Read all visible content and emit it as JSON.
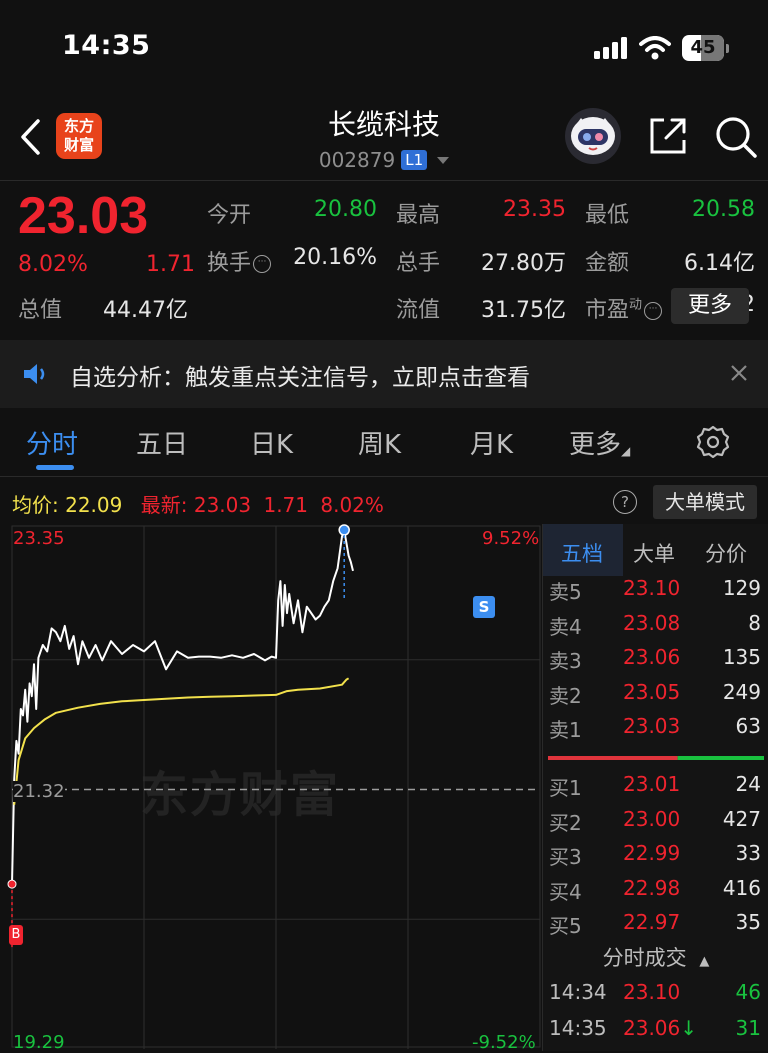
{
  "status": {
    "time": "14:35",
    "battery": "45",
    "battery_level": 0.45
  },
  "header": {
    "logo_line1": "东方",
    "logo_line2": "财富",
    "name": "长缆科技",
    "code": "002879",
    "level_badge": "L1"
  },
  "quote": {
    "price": "23.03",
    "change_pct": "8.02%",
    "change_abs": "1.71",
    "fields": [
      {
        "label": "今开",
        "value": "20.80",
        "color": "green"
      },
      {
        "label": "最高",
        "value": "23.35",
        "color": "red"
      },
      {
        "label": "最低",
        "value": "20.58",
        "color": "green"
      },
      {
        "label": "换手",
        "value": "20.16%",
        "color": "white"
      },
      {
        "label": "总手",
        "value": "27.80万",
        "color": "white"
      },
      {
        "label": "金额",
        "value": "6.14亿",
        "color": "white"
      },
      {
        "label": "总值",
        "value": "44.47亿",
        "color": "white"
      },
      {
        "label": "流值",
        "value": "31.75亿",
        "color": "white"
      },
      {
        "label": "市盈",
        "label_sup": "动",
        "value": "99.72",
        "color": "white"
      }
    ],
    "more_label": "更多"
  },
  "notice": {
    "text": "自选分析：触发重点关注信号，立即点击查看"
  },
  "tabs": [
    "分时",
    "五日",
    "日K",
    "周K",
    "月K",
    "更多"
  ],
  "chart_info": {
    "avg_label": "均价:",
    "avg_value": "22.09",
    "latest_label": "最新:",
    "latest_price": "23.03",
    "latest_chg": "1.71",
    "latest_pct": "8.02%",
    "help": "?",
    "mode_label": "大单模式"
  },
  "chart_data": {
    "type": "line",
    "y_max_label": "23.35",
    "y_mid_label": "21.32",
    "y_min_label": "19.29",
    "pct_max_label": "9.52%",
    "pct_min_label": "-9.52%",
    "ylim": [
      19.29,
      23.35
    ],
    "prev_close": 21.32,
    "watermark": "东方财富",
    "buy_marker": "B",
    "sell_marker": "S",
    "series": [
      {
        "name": "price",
        "color": "#ffffff",
        "x": [
          0,
          1,
          2,
          3,
          4,
          5,
          6,
          7,
          8,
          9,
          10,
          11,
          12,
          14,
          16,
          18,
          20,
          22,
          24,
          26,
          28,
          30,
          32,
          35,
          38,
          41,
          45,
          50,
          55,
          60,
          65,
          70,
          75,
          80,
          85,
          90,
          95,
          100,
          105,
          110,
          115,
          118,
          120,
          121,
          122,
          123,
          124,
          125,
          126,
          128,
          130,
          132,
          134,
          136,
          138,
          140,
          142,
          144,
          146,
          148,
          150,
          151,
          152,
          153,
          154,
          155
        ],
        "y": [
          20.58,
          21.4,
          21.7,
          21.6,
          21.95,
          21.9,
          22.1,
          21.85,
          22.15,
          22.05,
          22.3,
          21.95,
          22.35,
          22.45,
          22.4,
          22.58,
          22.55,
          22.48,
          22.6,
          22.42,
          22.52,
          22.3,
          22.48,
          22.35,
          22.45,
          22.33,
          22.48,
          22.38,
          22.45,
          22.4,
          22.48,
          22.26,
          22.4,
          22.35,
          22.36,
          22.36,
          22.35,
          22.37,
          22.35,
          22.38,
          22.33,
          22.36,
          22.35,
          22.8,
          22.95,
          22.6,
          22.92,
          22.7,
          22.85,
          22.62,
          22.8,
          22.55,
          22.75,
          22.7,
          22.65,
          22.68,
          22.75,
          22.8,
          22.95,
          23.05,
          23.3,
          23.35,
          23.25,
          23.15,
          23.1,
          23.03
        ]
      },
      {
        "name": "avg",
        "color": "#f2e14c",
        "x": [
          1,
          3,
          6,
          10,
          15,
          20,
          30,
          40,
          50,
          60,
          70,
          80,
          90,
          100,
          110,
          120,
          125,
          130,
          140,
          150,
          152,
          153
        ],
        "y": [
          21.2,
          21.55,
          21.72,
          21.8,
          21.87,
          21.92,
          21.96,
          21.99,
          22.01,
          22.02,
          22.03,
          22.04,
          22.045,
          22.05,
          22.055,
          22.06,
          22.09,
          22.1,
          22.11,
          22.14,
          22.18,
          22.19
        ]
      }
    ],
    "x_total": 240
  },
  "book": {
    "tabs": [
      "五档",
      "大单",
      "分价"
    ],
    "asks": [
      {
        "label": "卖5",
        "price": "23.10",
        "vol": "129"
      },
      {
        "label": "卖4",
        "price": "23.08",
        "vol": "8"
      },
      {
        "label": "卖3",
        "price": "23.06",
        "vol": "135"
      },
      {
        "label": "卖2",
        "price": "23.05",
        "vol": "249"
      },
      {
        "label": "卖1",
        "price": "23.03",
        "vol": "63"
      }
    ],
    "bids": [
      {
        "label": "买1",
        "price": "23.01",
        "vol": "24"
      },
      {
        "label": "买2",
        "price": "23.00",
        "vol": "427"
      },
      {
        "label": "买3",
        "price": "22.99",
        "vol": "33"
      },
      {
        "label": "买4",
        "price": "22.98",
        "vol": "416"
      },
      {
        "label": "买5",
        "price": "22.97",
        "vol": "35"
      }
    ],
    "ask_ratio": 0.6,
    "ticks_title": "分时成交",
    "ticks": [
      {
        "time": "14:34",
        "price": "23.10",
        "vol": "46",
        "dir": ""
      },
      {
        "time": "14:35",
        "price": "23.06",
        "vol": "31",
        "dir": "↓"
      }
    ]
  }
}
